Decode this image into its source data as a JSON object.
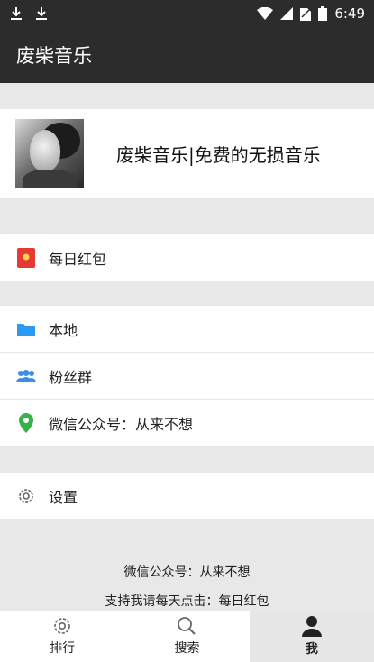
{
  "status_bar": {
    "time": "6:49",
    "icons": [
      "download-icon",
      "download-icon",
      "wifi-icon",
      "signal-icon",
      "no-sim-icon",
      "battery-icon"
    ]
  },
  "app_bar": {
    "title": "废柴音乐"
  },
  "profile": {
    "name": "废柴音乐|免费的无损音乐",
    "avatar": "avatar-photo"
  },
  "menu": {
    "group1": [
      {
        "label": "每日红包",
        "icon": "red-envelope-icon"
      }
    ],
    "group2": [
      {
        "label": "本地",
        "icon": "folder-icon"
      },
      {
        "label": "粉丝群",
        "icon": "group-icon"
      },
      {
        "label": "微信公众号：从来不想",
        "icon": "location-pin-icon"
      }
    ],
    "group3": [
      {
        "label": "设置",
        "icon": "gear-icon"
      }
    ]
  },
  "footer": {
    "line1": "微信公众号：从来不想",
    "line2": "支持我请每天点击：每日红包"
  },
  "bottom_nav": [
    {
      "label": "排行",
      "icon": "gear-icon",
      "active": false
    },
    {
      "label": "搜索",
      "icon": "search-icon",
      "active": false
    },
    {
      "label": "我",
      "icon": "person-icon",
      "active": true
    }
  ],
  "colors": {
    "bar_bg": "#2c2c2c",
    "page_bg": "#e8e8e8",
    "red_envelope": "#e53935",
    "folder": "#2b9af3",
    "group": "#3d8ee6",
    "pin": "#35b24a"
  }
}
